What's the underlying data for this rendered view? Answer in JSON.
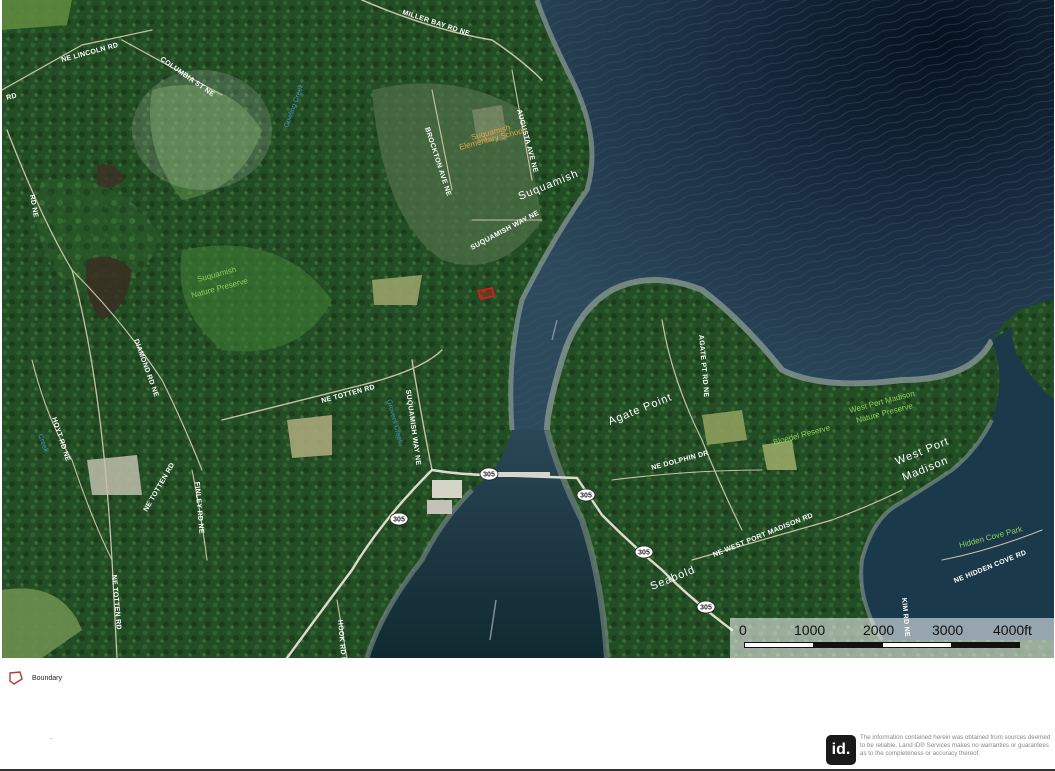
{
  "map": {
    "roads": {
      "miller_bay": "MILLER BAY RD NE",
      "lincoln": "NE LINCOLN RD",
      "columbia": "COLUMBIA ST NE",
      "rd_left": "RD",
      "augusta": "AUGUSTA AVE NE",
      "brockton": "BROCKTON AVE NE",
      "suquamish_way": "SUQUAMISH WAY NE",
      "rd_ne_left": "RD NE",
      "diamond": "DIAMOND RD NE",
      "totten_ne": "NE TOTTEN RD",
      "suquamish_way_vertical": "SUQUAMISH WAY NE",
      "hoyt": "HOYT RD NE",
      "totten_left": "NE TOTTEN RD",
      "finley": "FINLEY RD NE",
      "totten_vertical": "NE TOTTEN RD",
      "hook": "HOOK RD NE",
      "agate_left": "AGATE PT RD NE",
      "dolphin": "NE DOLPHIN DR",
      "west_port_madison": "NE WEST PORT MADISON RD",
      "hidden_cove": "NE HIDDEN COVE RD",
      "kim": "KIM RD NE",
      "agate_bottom": "AGATE PT RD NE"
    },
    "places": {
      "suquamish": "Suquamish",
      "agate_point": "Agate Point",
      "west_port_madison_1": "West Port",
      "west_port_madison_2": "Madison",
      "seabold": "Seabold"
    },
    "parks": {
      "nature_preserve_1": "Suquamish",
      "nature_preserve_2": "Nature Preserve",
      "bloedel": "Bloedel Reserve",
      "wpm_preserve_1": "West Port Madison",
      "wpm_preserve_2": "Nature Preserve",
      "hidden_cove_park": "Hidden Cove Park"
    },
    "water": {
      "creek_1": "Cowling Creek",
      "creek_2": "Grovers Creek",
      "creek_3": "Creek"
    },
    "school": {
      "line1": "Suquamish",
      "line2": "Elementary School"
    },
    "highway": "305",
    "colors": {
      "forest": "#1f4a22",
      "water_dark": "#0f2238",
      "water_mid": "#1e3e52",
      "shore": "#8c9c98",
      "boundary": "#e01a1a"
    }
  },
  "scale": {
    "ticks": [
      "0",
      "1000",
      "2000",
      "3000",
      "4000ft"
    ]
  },
  "legend": {
    "label": "Boundary"
  },
  "footer": {
    "logo": "id.",
    "disclaimer": "The information contained herein was obtained from sources deemed to be reliable. Land iD® Services makes no warranties or guarantees as to the completeness or accuracy thereof."
  }
}
